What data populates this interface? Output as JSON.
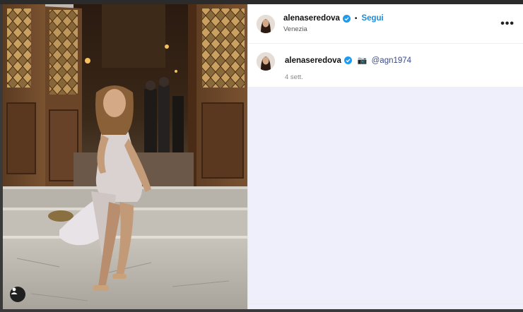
{
  "post": {
    "username": "alenaseredova",
    "follow_label": "Segui",
    "separator": "•",
    "location": "Venezia",
    "more_label": "•••",
    "caption_emoji": "📷",
    "caption_mention": "@agn1974",
    "time_ago": "4 sett."
  },
  "colors": {
    "accent": "#1a8cd8",
    "panel_bg": "#efeffb",
    "verified": "#1d9bf0"
  },
  "icons": {
    "verified": "verified-badge-icon",
    "user_tag": "person-icon",
    "more": "more-options-icon"
  }
}
